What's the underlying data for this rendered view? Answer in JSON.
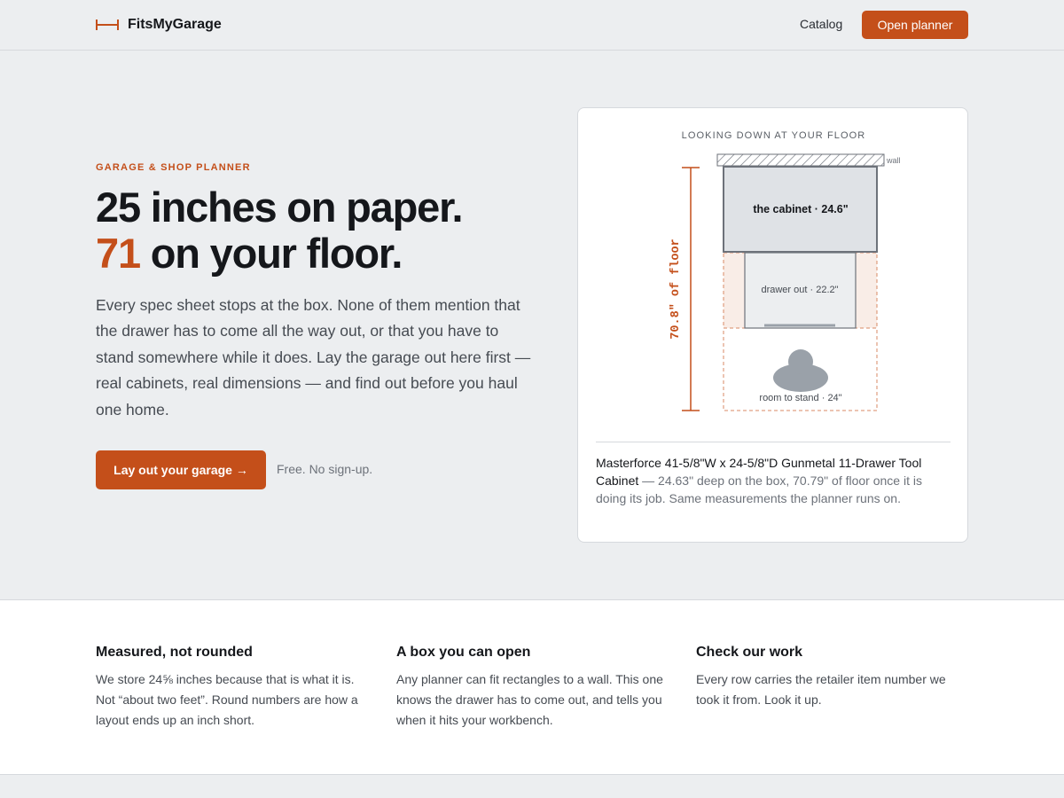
{
  "header": {
    "brand": "FitsMyGarage",
    "nav_catalog": "Catalog",
    "open_planner": "Open planner"
  },
  "hero": {
    "eyebrow": "GARAGE & SHOP PLANNER",
    "headline_line1": "25 inches on paper.",
    "headline_accent": "71",
    "headline_line2_rest": " on your floor.",
    "lede": "Every spec sheet stops at the box. None of them mention that the drawer has to come all the way out, or that you have to stand somewhere while it does. Lay the garage out here first — real cabinets, real dimensions — and find out before you haul one home.",
    "cta_label": "Lay out your garage →",
    "cta_note": "Free. No sign-up."
  },
  "card": {
    "label": "LOOKING DOWN AT YOUR FLOOR",
    "diagram": {
      "wall_label": "wall",
      "cabinet_label": "the cabinet · 24.6\"",
      "drawer_label": "drawer out · 22.2\"",
      "stand_label": "room to stand · 24\"",
      "total_label": "70.8\" of floor",
      "cabinet_depth_in": 24.6,
      "drawer_out_in": 22.2,
      "stand_room_in": 24,
      "total_floor_in": 70.8
    },
    "caption_title": "Masterforce 41-5/8\"W x 24-5/8\"D Gunmetal 11-Drawer Tool Cabinet",
    "caption_body": " — 24.63\" deep on the box, 70.79\" of floor once it is doing its job. Same measurements the planner runs on."
  },
  "features": [
    {
      "title": "Measured, not rounded",
      "body": "We store 24⅝ inches because that is what it is. Not “about two feet”. Round numbers are how a layout ends up an inch short."
    },
    {
      "title": "A box you can open",
      "body": "Any planner can fit rectangles to a wall. This one knows the drawer has to come out, and tells you when it hits your workbench."
    },
    {
      "title": "Check our work",
      "body": "Every row carries the retailer item number we took it from. Look it up."
    }
  ],
  "colors": {
    "accent": "#c44f1a",
    "background": "#eceef0",
    "card": "#ffffff"
  }
}
